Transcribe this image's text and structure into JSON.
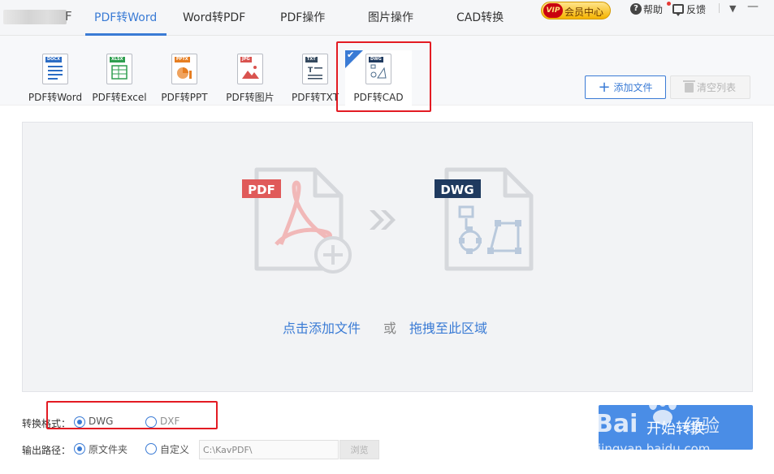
{
  "app": {
    "logo_suffix": "F"
  },
  "nav": {
    "tabs": [
      {
        "label": "PDF转Word",
        "active": true
      },
      {
        "label": "Word转PDF",
        "active": false
      },
      {
        "label": "PDF操作",
        "active": false
      },
      {
        "label": "图片操作",
        "active": false
      },
      {
        "label": "CAD转换",
        "active": false
      }
    ],
    "vip_label": "会员中心",
    "vip_badge": "VIP",
    "help_label": "帮助",
    "feedback_label": "反馈",
    "menu_icon": "▼",
    "minimize_icon": "—"
  },
  "tools": {
    "items": [
      {
        "label": "PDF转Word",
        "tag": "DOCX",
        "color": "#2b6cc4"
      },
      {
        "label": "PDF转Excel",
        "tag": "XLSX",
        "color": "#2e9e4f"
      },
      {
        "label": "PDF转PPT",
        "tag": "PPTX",
        "color": "#e67e22"
      },
      {
        "label": "PDF转图片",
        "tag": "JPG",
        "color": "#d9534f"
      },
      {
        "label": "PDF转TXT",
        "tag": "TXT",
        "color": "#34495e"
      },
      {
        "label": "PDF转CAD",
        "tag": "DWG",
        "color": "#1f3a5f",
        "selected": true
      }
    ],
    "add_file_label": "添加文件",
    "clear_list_label": "清空列表"
  },
  "dropzone": {
    "source_badge": "PDF",
    "target_badge": "DWG",
    "click_text": "点击添加文件",
    "or_text": "或",
    "drag_text": "拖拽至此区域",
    "colors": {
      "pdf": "#e05a5a",
      "dwg": "#1f3a5f",
      "link": "#3a7bd5"
    }
  },
  "options": {
    "format_label": "转换格式：",
    "format_options": [
      {
        "label": "DWG",
        "checked": true
      },
      {
        "label": "DXF",
        "checked": false
      }
    ],
    "output_label": "输出路径：",
    "output_options": [
      {
        "label": "原文件夹",
        "checked": true
      },
      {
        "label": "自定义",
        "checked": false
      }
    ],
    "path_value": "C:\\KavPDF\\",
    "browse_label": "浏览",
    "start_label": "开始转换"
  },
  "watermark": {
    "brand": "Bai",
    "brand_tail": "经验",
    "url": "jingyan.baidu.com"
  }
}
